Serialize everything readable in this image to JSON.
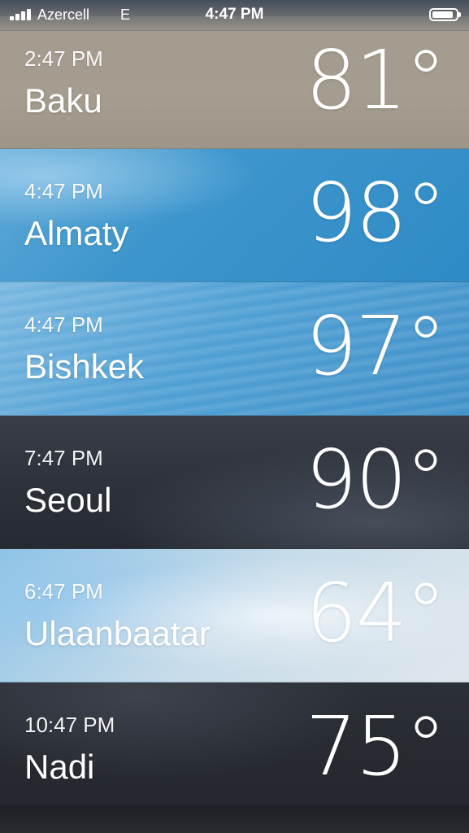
{
  "status_bar": {
    "carrier": "Azercell",
    "network": "E",
    "time": "4:47 PM",
    "signal_bars": 4
  },
  "cities": [
    {
      "time": "2:47 PM",
      "name": "Baku",
      "temp": "81°"
    },
    {
      "time": "4:47 PM",
      "name": "Almaty",
      "temp": "98°"
    },
    {
      "time": "4:47 PM",
      "name": "Bishkek",
      "temp": "97°"
    },
    {
      "time": "7:47 PM",
      "name": "Seoul",
      "temp": "90°"
    },
    {
      "time": "6:47 PM",
      "name": "Ulaanbaatar",
      "temp": "64°"
    },
    {
      "time": "10:47 PM",
      "name": "Nadi",
      "temp": "75°"
    }
  ],
  "colors": {
    "text": "#ffffff",
    "baku_bg": "#a39c8f",
    "almaty_bg": "#3d96cc",
    "bishkek_bg": "#4e9fd4",
    "seoul_bg": "#2c3039",
    "ulaanbaatar_bg": "#c7dcea",
    "nadi_bg": "#24272d"
  },
  "icons": {
    "signal": "signal-bars-icon",
    "battery": "battery-icon"
  }
}
